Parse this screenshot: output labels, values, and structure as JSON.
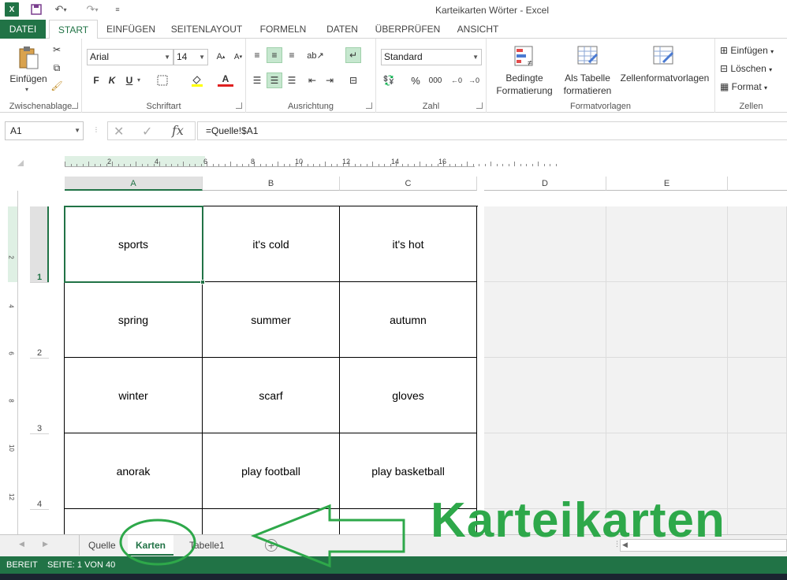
{
  "window": {
    "title": "Karteikarten Wörter - Excel"
  },
  "ribbon_tabs": [
    "DATEI",
    "START",
    "EINFÜGEN",
    "SEITENLAYOUT",
    "FORMELN",
    "DATEN",
    "ÜBERPRÜFEN",
    "ANSICHT"
  ],
  "clipboard": {
    "paste": "Einfügen",
    "label": "Zwischenablage"
  },
  "font": {
    "name": "Arial",
    "size": "14",
    "bold": "F",
    "italic": "K",
    "underline": "U",
    "color_letter": "A",
    "label": "Schriftart"
  },
  "alignment": {
    "label": "Ausrichtung"
  },
  "number": {
    "format": "Standard",
    "percent": "%",
    "thousands": "000",
    "label": "Zahl"
  },
  "styles": {
    "conditional_1": "Bedingte",
    "conditional_2": "Formatierung",
    "table_1": "Als Tabelle",
    "table_2": "formatieren",
    "cellstyles": "Zellenformatvorlagen",
    "label": "Formatvorlagen"
  },
  "cells_group": {
    "insert": "Einfügen",
    "delete": "Löschen",
    "format": "Format",
    "label": "Zellen"
  },
  "formula_bar": {
    "name_box": "A1",
    "fx": "fx",
    "formula": "=Quelle!$A1"
  },
  "ruler_marks": [
    "2",
    "4",
    "6",
    "8",
    "10",
    "12",
    "14",
    "16"
  ],
  "vruler_marks": [
    "2",
    "4",
    "6",
    "8",
    "10",
    "12"
  ],
  "columns": [
    "A",
    "B",
    "C",
    "D",
    "E"
  ],
  "rows": [
    "1",
    "2",
    "3",
    "4"
  ],
  "grid": [
    [
      "sports",
      "it's cold",
      "it's hot"
    ],
    [
      "spring",
      "summer",
      "autumn"
    ],
    [
      "winter",
      "scarf",
      "gloves"
    ],
    [
      "anorak",
      "play football",
      "play basketball"
    ]
  ],
  "sheet_tabs": [
    "Quelle",
    "Karten",
    "Tabelle1"
  ],
  "active_sheet": "Karten",
  "status": {
    "ready": "BEREIT",
    "page": "SEITE: 1 VON 40"
  },
  "annotation": {
    "text": "Karteikarten"
  },
  "colors": {
    "excel_green": "#217346",
    "annotation_green": "#2ea84a"
  }
}
